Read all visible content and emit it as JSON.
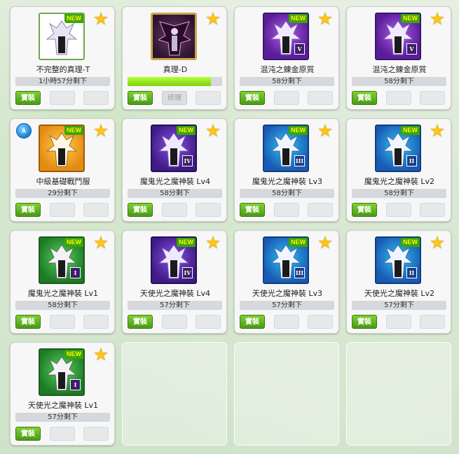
{
  "items": [
    {
      "name": "不完整的真理-T",
      "time": "1小時57分剩下",
      "new": true,
      "new_label": "NEW",
      "bg": "white",
      "grade": ""
    },
    {
      "name": "真理-D",
      "progress": 0.88,
      "new": false,
      "bg": "wine",
      "grade": "",
      "repair_label": "修理"
    },
    {
      "name": "混沌之錬金原質",
      "time": "58分剩下",
      "new": true,
      "new_label": "NEW",
      "bg": "purple",
      "grade": "V"
    },
    {
      "name": "混沌之錬金原質",
      "time": "58分剩下",
      "new": true,
      "new_label": "NEW",
      "bg": "purple",
      "grade": "V"
    },
    {
      "name": "中級基礎戰鬥服",
      "time": "29分剩下",
      "new": true,
      "new_label": "NEW",
      "bg": "orange",
      "grade": "",
      "badge": "A"
    },
    {
      "name": "魔鬼光之魔神裝 Lv4",
      "time": "58分剩下",
      "new": true,
      "new_label": "NEW",
      "bg": "violet",
      "grade": "IV"
    },
    {
      "name": "魔鬼光之魔神裝 Lv3",
      "time": "58分剩下",
      "new": true,
      "new_label": "NEW",
      "bg": "blue",
      "grade": "III"
    },
    {
      "name": "魔鬼光之魔神裝 Lv2",
      "time": "58分剩下",
      "new": true,
      "new_label": "NEW",
      "bg": "blue",
      "grade": "II"
    },
    {
      "name": "魔鬼光之魔神裝 Lv1",
      "time": "58分剩下",
      "new": true,
      "new_label": "NEW",
      "bg": "green",
      "grade": "I"
    },
    {
      "name": "天使光之魔神裝 Lv4",
      "time": "57分剩下",
      "new": true,
      "new_label": "NEW",
      "bg": "violet",
      "grade": "IV"
    },
    {
      "name": "天使光之魔神裝 Lv3",
      "time": "57分剩下",
      "new": true,
      "new_label": "NEW",
      "bg": "blue",
      "grade": "III"
    },
    {
      "name": "天使光之魔神裝 Lv2",
      "time": "57分剩下",
      "new": true,
      "new_label": "NEW",
      "bg": "blue",
      "grade": "II"
    },
    {
      "name": "天使光之魔神裝 Lv1",
      "time": "57分剩下",
      "new": true,
      "new_label": "NEW",
      "bg": "green",
      "grade": "I"
    }
  ],
  "equip_label": "實裝",
  "favorite_icon": "star-icon",
  "colors": {
    "equip_button": "#5fb31f",
    "star": "#ffc414",
    "new_badge": "#3aa40f",
    "progress_fill": "#8fe01a"
  }
}
